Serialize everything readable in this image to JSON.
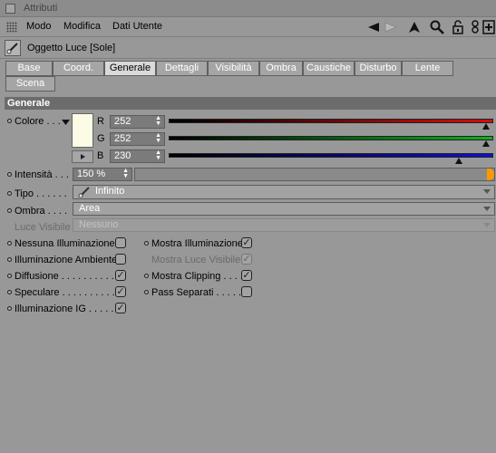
{
  "window": {
    "title": "Attributi"
  },
  "menu": {
    "items": [
      "Modo",
      "Modifica",
      "Dati Utente"
    ]
  },
  "toolbar": {
    "icons": [
      "arrow-left-icon",
      "arrow-right-icon",
      "arrow-up-icon",
      "search-icon",
      "lock-icon",
      "link-icon",
      "new-panel-icon"
    ]
  },
  "object": {
    "title": "Oggetto Luce [Sole]",
    "icon": "light-object-icon"
  },
  "tabs": [
    {
      "label": "Base"
    },
    {
      "label": "Coord."
    },
    {
      "label": "Generale"
    },
    {
      "label": "Dettagli"
    },
    {
      "label": "Visibilità"
    },
    {
      "label": "Ombra"
    },
    {
      "label": "Caustiche"
    },
    {
      "label": "Disturbo"
    },
    {
      "label": "Lente"
    },
    {
      "label": "Scena"
    }
  ],
  "active_tab": "Generale",
  "section": {
    "title": "Generale"
  },
  "color": {
    "label": "Colore . . .",
    "swatch": "#fcfce6",
    "channels": [
      {
        "name": "R",
        "value": "252",
        "fraction": 0.988,
        "color": "#d01010"
      },
      {
        "name": "G",
        "value": "252",
        "fraction": 0.988,
        "color": "#10b020"
      },
      {
        "name": "B",
        "value": "230",
        "fraction": 0.902,
        "color": "#1010d0"
      }
    ]
  },
  "intensity": {
    "label": "Intensità . . .",
    "value": "150 %",
    "fraction": 1.0,
    "accent": "#ff9900"
  },
  "type": {
    "label": "Tipo . . . . . .",
    "value": "Infinito"
  },
  "shadow": {
    "label": "Ombra . . . .",
    "value": "Area"
  },
  "visible_light": {
    "label": "Luce Visibile",
    "value": "Nessuno"
  },
  "checkboxes": {
    "left": [
      {
        "label": "Nessuna Illuminazione",
        "checked": false,
        "check_glyph": ""
      },
      {
        "label": "Illuminazione Ambiente",
        "checked": false,
        "check_glyph": ""
      },
      {
        "label": "Diffusione . . . . . . . . . .",
        "checked": true,
        "check_glyph": "✓"
      },
      {
        "label": "Speculare . . . . . . . . . .",
        "checked": true,
        "check_glyph": "✓"
      },
      {
        "label": "Illuminazione IG . . . . .",
        "checked": true,
        "check_glyph": "✓"
      }
    ],
    "right": [
      {
        "label": "Mostra Illuminazione",
        "checked": true,
        "check_glyph": "✓",
        "enabled": true
      },
      {
        "label": "Mostra Luce Visibile",
        "checked": true,
        "check_glyph": "✓",
        "enabled": false
      },
      {
        "label": "Mostra Clipping . . . .",
        "checked": true,
        "check_glyph": "✓",
        "enabled": true
      },
      {
        "label": "Pass Separati . . . . .",
        "checked": false,
        "check_glyph": "",
        "enabled": true
      }
    ]
  }
}
